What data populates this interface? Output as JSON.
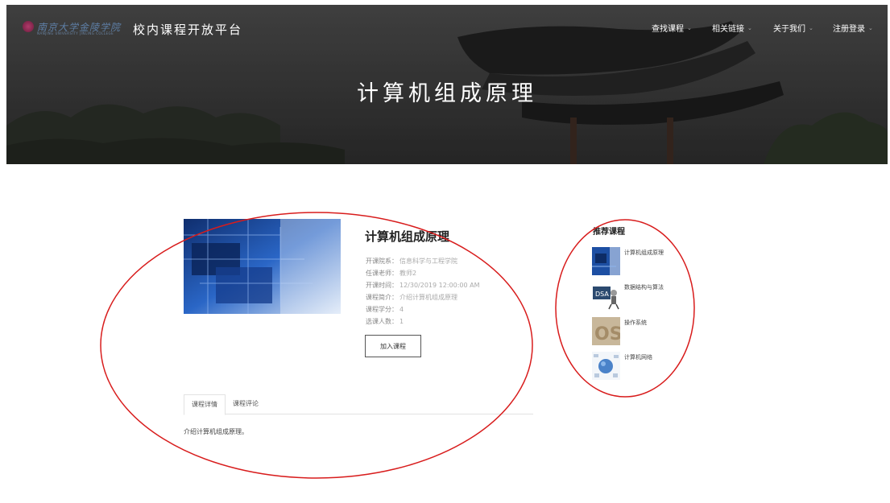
{
  "header": {
    "logo_cn": "南京大学金陵学院",
    "logo_en": "NANJING UNIVERSITY JINLING COLLEGE",
    "platform_title": "校内课程开放平台",
    "nav": [
      {
        "label": "查找课程"
      },
      {
        "label": "相关链接"
      },
      {
        "label": "关于我们"
      },
      {
        "label": "注册登录"
      }
    ]
  },
  "hero": {
    "title": "计算机组成原理"
  },
  "course": {
    "title": "计算机组成原理",
    "info": [
      {
        "label": "开课院系：",
        "value": "信息科学与工程学院"
      },
      {
        "label": "任课老师：",
        "value": "教师2"
      },
      {
        "label": "开课时间：",
        "value": "12/30/2019 12:00:00 AM"
      },
      {
        "label": "课程简介：",
        "value": "介绍计算机组成原理"
      },
      {
        "label": "课程学分：",
        "value": "4"
      },
      {
        "label": "选课人数：",
        "value": "1"
      }
    ],
    "join_label": "加入课程",
    "tabs": [
      {
        "label": "课程详情",
        "active": true
      },
      {
        "label": "课程评论",
        "active": false
      }
    ],
    "detail_text": "介绍计算机组成原理。"
  },
  "sidebar": {
    "title": "推荐课程",
    "items": [
      {
        "label": "计算机组成原理",
        "thumb": "circuit-board"
      },
      {
        "label": "数据结构与算法",
        "thumb": "dsa-robot"
      },
      {
        "label": "操作系统",
        "thumb": "os-letters",
        "thumb_text": "OS"
      },
      {
        "label": "计算机网络",
        "thumb": "network-globe"
      }
    ]
  },
  "colors": {
    "hero_bg": "#2b2b2b",
    "accent_annotation": "#d81c1c",
    "course_thumb_blue": "#1d4fa3"
  }
}
